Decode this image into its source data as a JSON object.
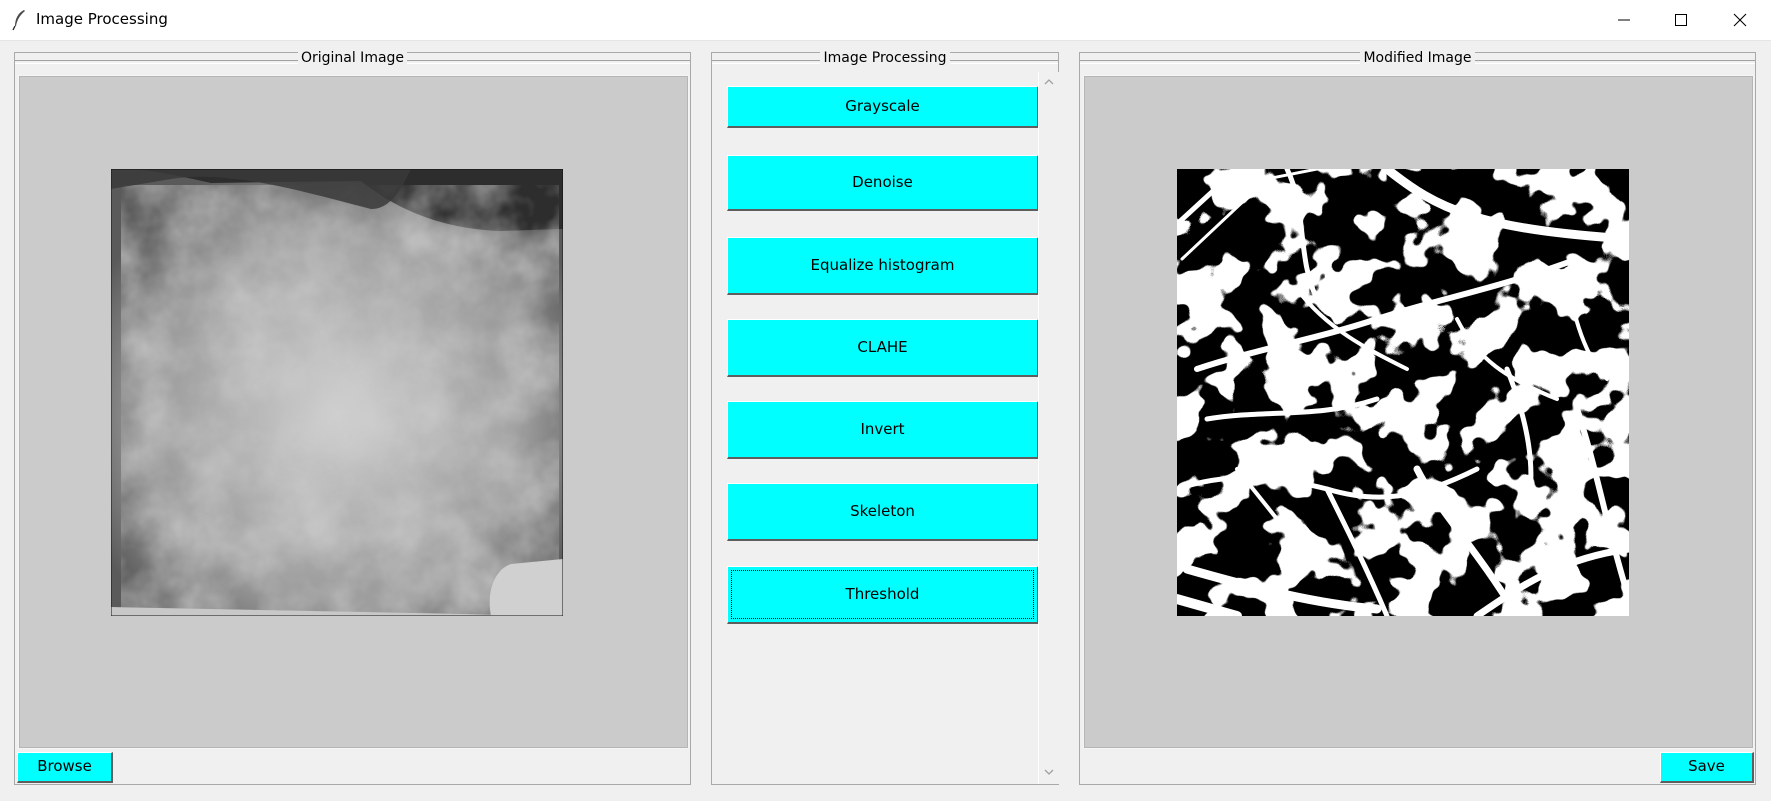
{
  "window": {
    "title": "Image Processing"
  },
  "left_panel": {
    "title": "Original Image",
    "browse_label": "Browse"
  },
  "center_panel": {
    "title": "Image Processing",
    "buttons": [
      {
        "label": "Grayscale"
      },
      {
        "label": "Denoise"
      },
      {
        "label": "Equalize histogram"
      },
      {
        "label": "CLAHE"
      },
      {
        "label": "Invert"
      },
      {
        "label": "Skeleton"
      },
      {
        "label": "Threshold"
      }
    ],
    "focused_button": "Threshold"
  },
  "right_panel": {
    "title": "Modified Image",
    "save_label": "Save"
  },
  "colors": {
    "button_bg": "#00ffff",
    "canvas_bg": "#cbcbcb",
    "window_bg": "#f0f0f0"
  },
  "icons": [
    "feather-app-icon",
    "minimize-icon",
    "maximize-icon",
    "close-icon",
    "scroll-up-icon",
    "scroll-down-icon"
  ]
}
